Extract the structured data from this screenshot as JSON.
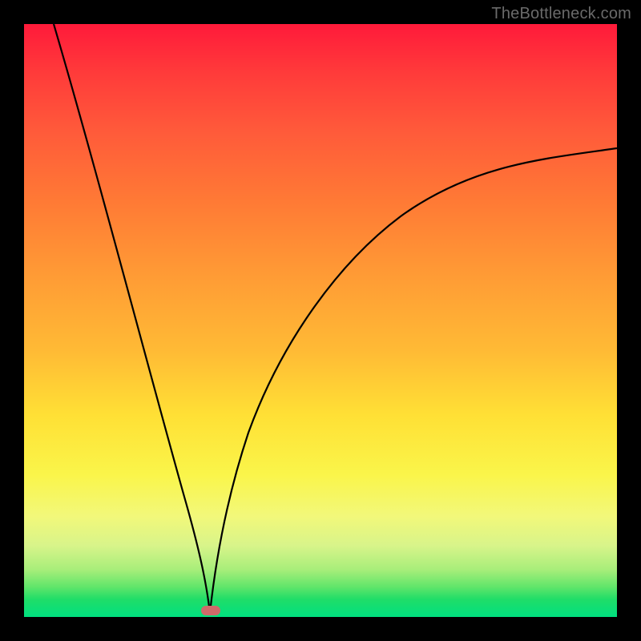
{
  "watermark": {
    "text": "TheBottleneck.com"
  },
  "chart_data": {
    "type": "line",
    "title": "",
    "xlabel": "",
    "ylabel": "",
    "xlim": [
      0,
      100
    ],
    "ylim": [
      0,
      100
    ],
    "background_gradient": {
      "direction": "vertical",
      "stops": [
        {
          "pos": 0.0,
          "color": "#ff1a3a"
        },
        {
          "pos": 0.5,
          "color": "#ffba35"
        },
        {
          "pos": 0.8,
          "color": "#f2f87a"
        },
        {
          "pos": 1.0,
          "color": "#00e080"
        }
      ]
    },
    "marker": {
      "x": 31,
      "y": 0,
      "color": "#d46a6a",
      "shape": "rounded-rect"
    },
    "series": [
      {
        "name": "left-branch",
        "x": [
          5,
          8,
          11,
          14,
          17,
          20,
          23,
          26,
          29,
          31
        ],
        "values": [
          100,
          88,
          77,
          66,
          55,
          44,
          33,
          22,
          10,
          0
        ],
        "color": "#000000"
      },
      {
        "name": "right-branch",
        "x": [
          31,
          32,
          34,
          37,
          40,
          44,
          48,
          53,
          58,
          64,
          70,
          77,
          84,
          92,
          100
        ],
        "values": [
          0,
          8,
          20,
          32,
          42,
          50,
          56,
          61,
          65,
          68,
          71,
          73,
          75,
          77,
          79
        ],
        "color": "#000000"
      }
    ]
  }
}
